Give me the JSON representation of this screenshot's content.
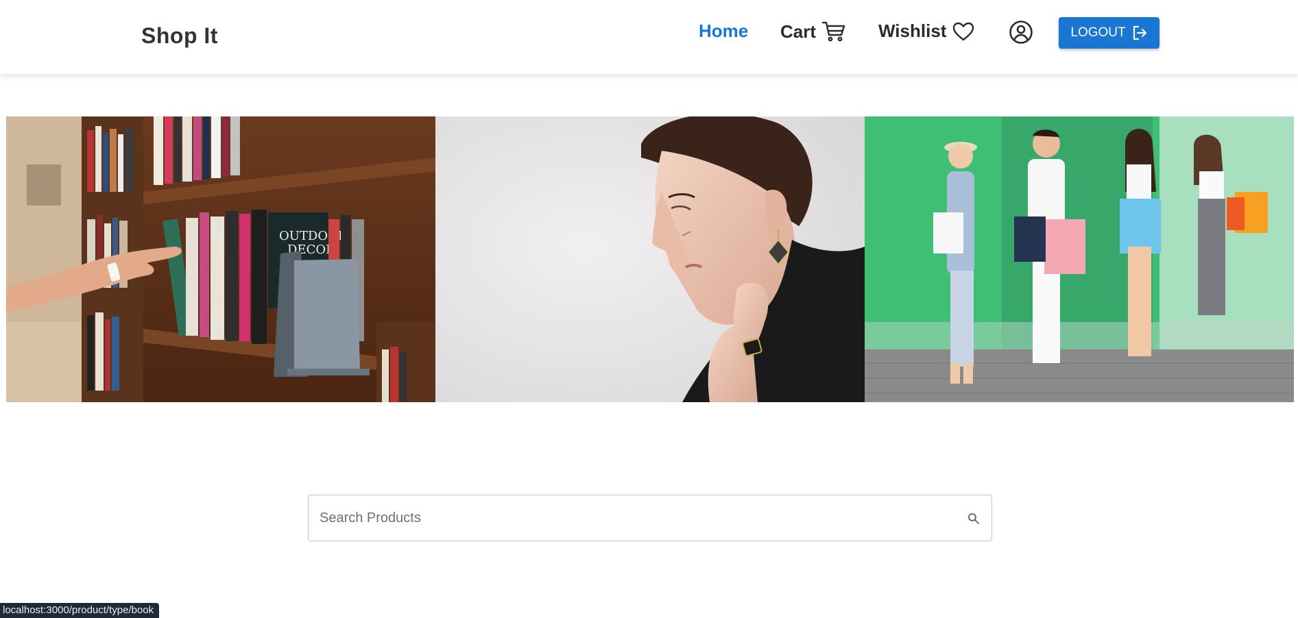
{
  "navbar": {
    "brand": "Shop It",
    "links": [
      {
        "label": "Home",
        "active": true
      },
      {
        "label": "Cart",
        "icon": "cart-icon"
      },
      {
        "label": "Wishlist",
        "icon": "heart-icon"
      }
    ],
    "account_icon": "account-circle-icon",
    "logout_label": "LOGOUT",
    "logout_icon": "logout-icon"
  },
  "banner": {
    "slides": [
      {
        "name": "books",
        "description": "bookshelf with books"
      },
      {
        "name": "jewellery",
        "description": "woman wearing earrings and ring"
      },
      {
        "name": "fashion",
        "description": "friends with shopping bags"
      }
    ]
  },
  "search": {
    "placeholder": "Search Products",
    "icon": "search-icon"
  },
  "status_bar": {
    "url": "localhost:3000/product/type/book"
  },
  "colors": {
    "primary": "#1976d2",
    "text": "#2b2b2b",
    "brand_text": "#333333"
  }
}
